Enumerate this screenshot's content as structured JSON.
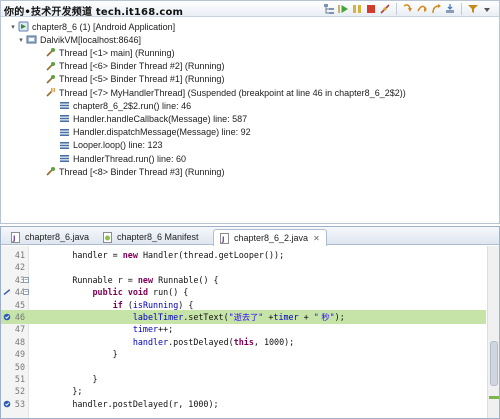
{
  "watermark": "你的•技术开发频道 tech.it168.com",
  "toolbar": {
    "icons": [
      "tree-icon",
      "resume-icon",
      "suspend-icon",
      "terminate-icon",
      "disconnect-icon",
      "step-into-icon",
      "step-over-icon",
      "step-return-icon",
      "drop-to-frame-icon",
      "use-step-filters-icon",
      "view-menu-icon"
    ]
  },
  "tree": {
    "items": [
      {
        "label": "chapter8_6 (1) [Android Application]",
        "icon": "launch-icon",
        "level": 0
      },
      {
        "label": "DalvikVM[localhost:8646]",
        "icon": "vm-icon",
        "level": 1
      },
      {
        "label": "Thread [<1> main] (Running)",
        "icon": "thread-running-icon",
        "level": 2
      },
      {
        "label": "Thread [<6> Binder Thread #2] (Running)",
        "icon": "thread-running-icon",
        "level": 2
      },
      {
        "label": "Thread [<5> Binder Thread #1] (Running)",
        "icon": "thread-running-icon",
        "level": 2
      },
      {
        "label": "Thread [<7> MyHandlerThread] (Suspended (breakpoint at line 46 in chapter8_6_2$2))",
        "icon": "thread-suspended-icon",
        "level": 2
      },
      {
        "label": "chapter8_6_2$2.run() line: 46",
        "icon": "stack-frame-icon",
        "level": 3
      },
      {
        "label": "Handler.handleCallback(Message) line: 587",
        "icon": "stack-frame-icon",
        "level": 3
      },
      {
        "label": "Handler.dispatchMessage(Message) line: 92",
        "icon": "stack-frame-icon",
        "level": 3
      },
      {
        "label": "Looper.loop() line: 123",
        "icon": "stack-frame-icon",
        "level": 3
      },
      {
        "label": "HandlerThread.run() line: 60",
        "icon": "stack-frame-icon",
        "level": 3
      },
      {
        "label": "Thread [<8> Binder Thread #3] (Running)",
        "icon": "thread-running-icon",
        "level": 2
      }
    ]
  },
  "editor": {
    "tabs": [
      {
        "label": "chapter8_6.java",
        "active": false
      },
      {
        "label": "chapter8_6 Manifest",
        "active": false
      },
      {
        "label": "chapter8_6_2.java",
        "active": true,
        "close": "✕"
      }
    ],
    "lines": [
      {
        "num": "41",
        "html_segments": [
          [
            "",
            "        handler = "
          ],
          [
            "kw",
            "new"
          ],
          [
            "",
            " Handler(thread.getLooper());"
          ]
        ]
      },
      {
        "num": "42",
        "html_segments": []
      },
      {
        "num": "43",
        "fold": "⊖",
        "html_segments": [
          [
            "",
            "        Runnable r = "
          ],
          [
            "kw",
            "new"
          ],
          [
            "",
            " Runnable() {"
          ]
        ]
      },
      {
        "num": "44",
        "fold": "⊖",
        "marker": "override",
        "html_segments": [
          [
            "",
            "            "
          ],
          [
            "kw",
            "public"
          ],
          [
            "",
            " "
          ],
          [
            "kw",
            "void"
          ],
          [
            "",
            " run() {"
          ]
        ]
      },
      {
        "num": "45",
        "html_segments": [
          [
            "",
            "                "
          ],
          [
            "kw",
            "if"
          ],
          [
            "",
            " ("
          ],
          [
            "fld",
            "isRunning"
          ],
          [
            "",
            ") {"
          ]
        ]
      },
      {
        "num": "46",
        "current": true,
        "marker": "breakpoint",
        "html_segments": [
          [
            "",
            "                    "
          ],
          [
            "fld",
            "labelTimer"
          ],
          [
            "",
            ".setText("
          ],
          [
            "str",
            "\""
          ],
          [
            "cn",
            "逝去了"
          ],
          [
            "str",
            "\""
          ],
          [
            "",
            " +"
          ],
          [
            "fld",
            "timer"
          ],
          [
            "",
            " + "
          ],
          [
            "str",
            "\""
          ],
          [
            "cn",
            " 秒"
          ],
          [
            "str",
            "\""
          ],
          [
            "",
            ");"
          ]
        ]
      },
      {
        "num": "47",
        "html_segments": [
          [
            "",
            "                    "
          ],
          [
            "fld",
            "timer"
          ],
          [
            "",
            "++;"
          ]
        ]
      },
      {
        "num": "48",
        "html_segments": [
          [
            "",
            "                    "
          ],
          [
            "fld",
            "handler"
          ],
          [
            "",
            ".postDelayed("
          ],
          [
            "kw",
            "this"
          ],
          [
            "",
            ", 1000);"
          ]
        ]
      },
      {
        "num": "49",
        "html_segments": [
          [
            "",
            "                }"
          ]
        ]
      },
      {
        "num": "50",
        "html_segments": []
      },
      {
        "num": "51",
        "html_segments": [
          [
            "",
            "            }"
          ]
        ]
      },
      {
        "num": "52",
        "html_segments": [
          [
            "",
            "        };"
          ]
        ]
      },
      {
        "num": "53",
        "marker": "breakpoint",
        "html_segments": [
          [
            "",
            "        handler.postDelayed(r, 1000);"
          ]
        ]
      }
    ]
  },
  "colors": {
    "current_line": "#c6e3a8",
    "keyword": "#7f0055",
    "string": "#2a00ff",
    "field": "#0000c0"
  }
}
